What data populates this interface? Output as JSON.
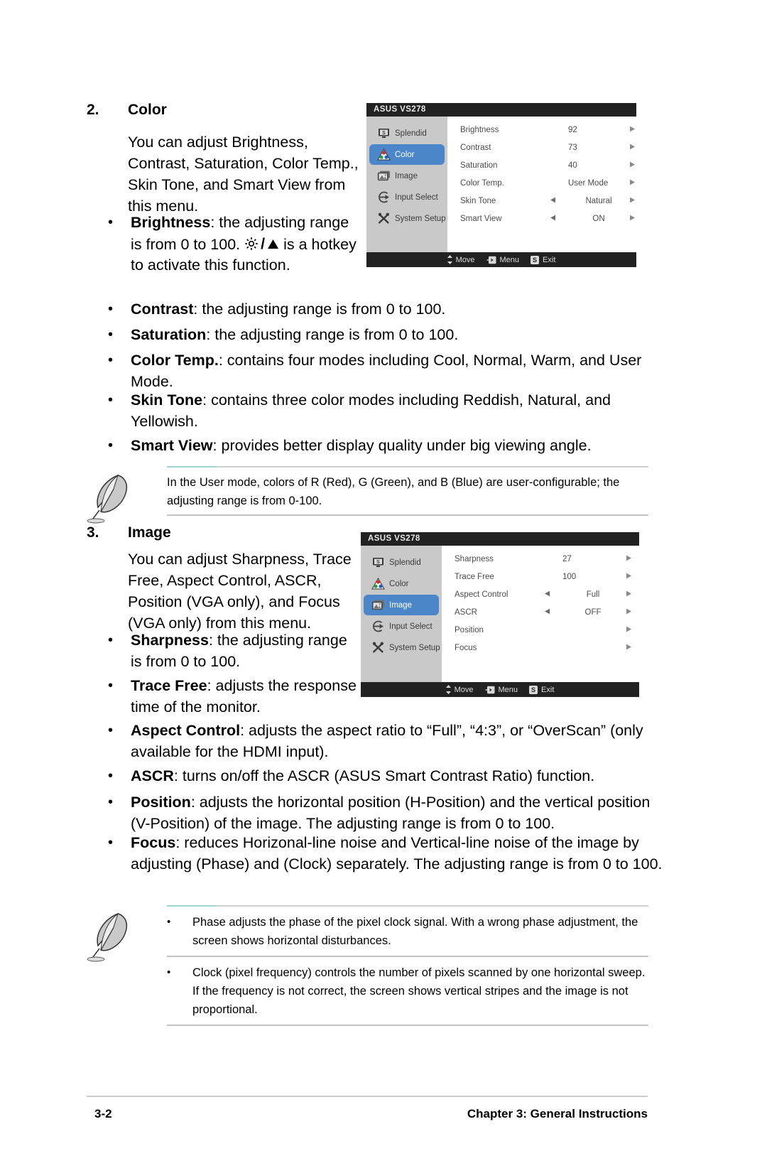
{
  "sections": [
    {
      "number": "2.",
      "title": "Color",
      "intro": "You can adjust Brightness, Contrast, Saturation, Color Temp., Skin Tone, and Smart View from this menu.",
      "bullets": [
        {
          "term": "Brightness",
          "sep": ": ",
          "text_before_hotkey": "the adjusting range is from 0 to 100. ",
          "hotkey": "sun-slash-up-triangle",
          "text_after_hotkey": " is a hotkey to activate this function."
        },
        {
          "term": "Contrast",
          "sep": ": ",
          "text": "the adjusting range is from 0 to 100."
        },
        {
          "term": "Saturation",
          "sep": ": ",
          "text": "the adjusting range is from 0 to 100."
        },
        {
          "term": "Color Temp.",
          "sep": ": ",
          "text": "contains four modes including Cool, Normal, Warm, and User Mode."
        },
        {
          "term": "Skin Tone",
          "sep": ": ",
          "text": "contains three color modes including Reddish, Natural, and Yellowish."
        },
        {
          "term": "Smart View",
          "sep": ": ",
          "text": "provides better display quality under big viewing angle."
        }
      ]
    },
    {
      "number": "3.",
      "title": "Image",
      "intro": "You can adjust Sharpness, Trace Free, Aspect Control, ASCR, Position (VGA only), and Focus (VGA only) from this menu.",
      "bullets": [
        {
          "term": "Sharpness",
          "sep": ": ",
          "text": "the adjusting range is from 0 to 100."
        },
        {
          "term": "Trace Free",
          "sep": ": ",
          "text": "adjusts the response time of the monitor."
        },
        {
          "term": "Aspect Control",
          "sep": ": ",
          "text": "adjusts the aspect ratio to “Full”, “4:3”, or “OverScan” (only available for the HDMI input)."
        },
        {
          "term": "ASCR",
          "sep": ": ",
          "text": "turns on/off the ASCR (ASUS Smart Contrast Ratio) function."
        },
        {
          "term": "Position",
          "sep": ": ",
          "text": "adjusts the horizontal position (H-Position) and the vertical position (V-Position) of the image. The adjusting range is from 0 to 100."
        },
        {
          "term": "Focus",
          "sep": ": ",
          "text": "reduces Horizonal-line noise and Vertical-line noise of the image by adjusting (Phase) and (Clock) separately. The adjusting range is from 0 to 100."
        }
      ]
    }
  ],
  "notes": [
    {
      "icon": "note-feather-icon",
      "paragraphs": [
        "In the User mode, colors of R (Red), G (Green), and B (Blue) are user-configurable; the adjusting range is from 0-100."
      ]
    },
    {
      "icon": "note-feather-icon",
      "bullets": [
        "Phase adjusts the phase of the pixel clock signal. With a wrong phase adjustment, the screen shows horizontal disturbances.",
        "Clock (pixel frequency) controls the number of pixels scanned by one horizontal sweep. If the frequency is not correct, the screen shows vertical stripes and the image is not proportional."
      ]
    }
  ],
  "osd_color": {
    "title": "ASUS VS278",
    "sidebar": [
      {
        "icon": "splendid-monitor-icon",
        "label": "Splendid",
        "active": false
      },
      {
        "icon": "color-triangle-rgb-icon",
        "label": "Color",
        "active": true
      },
      {
        "icon": "image-picture-icon",
        "label": "Image",
        "active": false
      },
      {
        "icon": "input-select-arrow-icon",
        "label": "Input Select",
        "active": false
      },
      {
        "icon": "system-setup-tools-icon",
        "label": "System Setup",
        "active": false
      }
    ],
    "rows": [
      {
        "label": "Brightness",
        "left_arrow": false,
        "value": "92",
        "right_arrow": true
      },
      {
        "label": "Contrast",
        "left_arrow": false,
        "value": "73",
        "right_arrow": true
      },
      {
        "label": "Saturation",
        "left_arrow": false,
        "value": "40",
        "right_arrow": true
      },
      {
        "label": "Color Temp.",
        "left_arrow": false,
        "value": "User Mode",
        "right_arrow": true
      },
      {
        "label": "Skin Tone",
        "left_arrow": true,
        "value": "Natural",
        "right_arrow": true
      },
      {
        "label": "Smart View",
        "left_arrow": true,
        "value": "ON",
        "right_arrow": true
      }
    ],
    "footer": [
      {
        "icon": "updown-arrows-icon",
        "label": "Move"
      },
      {
        "icon": "menu-key-icon",
        "label": "Menu"
      },
      {
        "icon": "splendid-key-icon",
        "key": "S",
        "label": "Exit"
      }
    ]
  },
  "osd_image": {
    "title": "ASUS VS278",
    "sidebar": [
      {
        "icon": "splendid-monitor-icon",
        "label": "Splendid",
        "active": false
      },
      {
        "icon": "color-triangle-rgb-icon",
        "label": "Color",
        "active": false
      },
      {
        "icon": "image-picture-icon",
        "label": "Image",
        "active": true
      },
      {
        "icon": "input-select-arrow-icon",
        "label": "Input Select",
        "active": false
      },
      {
        "icon": "system-setup-tools-icon",
        "label": "System Setup",
        "active": false
      }
    ],
    "rows": [
      {
        "label": "Sharpness",
        "left_arrow": false,
        "value": "27",
        "right_arrow": true
      },
      {
        "label": "Trace Free",
        "left_arrow": false,
        "value": "100",
        "right_arrow": true
      },
      {
        "label": "Aspect Control",
        "left_arrow": true,
        "value": "Full",
        "right_arrow": true
      },
      {
        "label": "ASCR",
        "left_arrow": true,
        "value": "OFF",
        "right_arrow": true
      },
      {
        "label": "Position",
        "left_arrow": false,
        "value": "",
        "right_arrow": true
      },
      {
        "label": "Focus",
        "left_arrow": false,
        "value": "",
        "right_arrow": true
      }
    ],
    "footer": [
      {
        "icon": "updown-arrows-icon",
        "label": "Move"
      },
      {
        "icon": "menu-key-icon",
        "label": "Menu"
      },
      {
        "icon": "splendid-key-icon",
        "key": "S",
        "label": "Exit"
      }
    ]
  },
  "page_footer": {
    "page_number": "3-2",
    "chapter": "Chapter 3: General Instructions"
  },
  "colors": {
    "osd_highlight": "#4a86c8",
    "osd_sidebar_bg": "#c9c9c9",
    "osd_titlebar_bg": "#222222",
    "note_rule_accent": "#9fd4d4"
  }
}
